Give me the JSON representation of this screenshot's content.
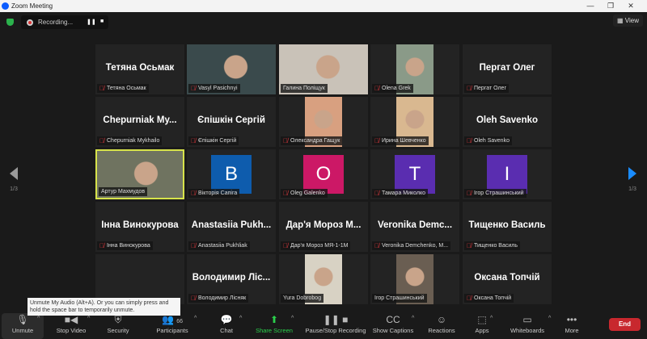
{
  "window": {
    "title": "Zoom Meeting",
    "minimize": "—",
    "maximize": "❐",
    "close": "✕"
  },
  "topbar": {
    "recording_label": "Recording...",
    "pause": "❚❚",
    "stop": "■",
    "view_label": "View",
    "view_icon": "▦"
  },
  "nav": {
    "page": "1/3",
    "page_right": "1/3"
  },
  "tiles": [
    {
      "type": "name",
      "display": "Тетяна Осьмак",
      "label": "Тетяна Осьмак",
      "muted": true
    },
    {
      "type": "video",
      "label": "Vasyl Pasichnyi",
      "muted": true,
      "color": "#3a4a4c"
    },
    {
      "type": "video",
      "label": "Галина Поліщук",
      "muted": false,
      "color": "#c9c2b8"
    },
    {
      "type": "photo",
      "label": "Olena Grek",
      "muted": true,
      "color": "#8a9a88"
    },
    {
      "type": "name",
      "display": "Пергат Олег",
      "label": "Пергат Олег",
      "muted": true
    },
    {
      "type": "name",
      "display": "Chepurniak  My...",
      "label": "Chepurniak Mykhailo",
      "muted": true
    },
    {
      "type": "name",
      "display": "Єпішкін Сергій",
      "label": "Єпішкін Сергій",
      "muted": true
    },
    {
      "type": "photo",
      "label": "Олександра Гащук",
      "muted": true,
      "color": "#d8a080"
    },
    {
      "type": "photo",
      "label": "Ирина Шевченко",
      "muted": true,
      "color": "#d9b890"
    },
    {
      "type": "name",
      "display": "Oleh Savenko",
      "label": "Oleh Savenko",
      "muted": true
    },
    {
      "type": "video",
      "label": "Артур Махмудов",
      "muted": false,
      "active": true,
      "color": "#6f7360"
    },
    {
      "type": "avatar",
      "letter": "B",
      "label": "Вікторія Сапіга",
      "muted": true,
      "color": "#0e5cad"
    },
    {
      "type": "avatar",
      "letter": "O",
      "label": "Oleg Galenko",
      "muted": true,
      "color": "#cc1866"
    },
    {
      "type": "avatar",
      "letter": "T",
      "label": "Тамара Миколко",
      "muted": true,
      "color": "#5a2db0"
    },
    {
      "type": "avatar",
      "letter": "I",
      "label": "Ігор Страшинський",
      "muted": true,
      "color": "#5a2db0"
    },
    {
      "type": "name",
      "display": "Інна Винокурова",
      "label": "Інна Винокурова",
      "muted": true
    },
    {
      "type": "name",
      "display": "Anastasiia  Pukh...",
      "label": "Anastasiia Pukhliak",
      "muted": true
    },
    {
      "type": "name",
      "display": "Дар'я  Мороз  М...",
      "label": "Дар'я Мороз МЯ-1-1М",
      "muted": true
    },
    {
      "type": "name",
      "display": "Veronika  Demc...",
      "label": "Veronika Demchenko, M...",
      "muted": true
    },
    {
      "type": "name",
      "display": "Тищенко Василь",
      "label": "Тищенко Василь",
      "muted": true
    },
    {
      "type": "empty"
    },
    {
      "type": "name",
      "display": "Володимир  Ліс...",
      "label": "Володимир Лісняк",
      "muted": true
    },
    {
      "type": "photo",
      "label": "Yura Dobrobog",
      "muted": false,
      "color": "#d8d2c4"
    },
    {
      "type": "photo",
      "label": "Ігор Страшинський",
      "muted": false,
      "color": "#6a5e52"
    },
    {
      "type": "name",
      "display": "Оксана Топчій",
      "label": "Оксана Топчій",
      "muted": true
    }
  ],
  "tooltip": "Unmute My Audio (Alt+A). Or you can simply press and hold the space bar to temporarily unmute.",
  "toolbar": [
    {
      "id": "unmute",
      "label": "Unmute",
      "icon": "🎙",
      "caret": true
    },
    {
      "id": "stop-video",
      "label": "Stop Video",
      "icon": "■◀",
      "caret": true
    },
    {
      "id": "security",
      "label": "Security",
      "icon": "⛨",
      "caret": false
    },
    {
      "id": "participants",
      "label": "Participants",
      "icon": "👥",
      "count": "66",
      "caret": true
    },
    {
      "id": "chat",
      "label": "Chat",
      "icon": "💬",
      "caret": true
    },
    {
      "id": "share-screen",
      "label": "Share Screen",
      "icon": "⬆",
      "caret": true,
      "color": "#2bd04c"
    },
    {
      "id": "pause-stop-recording",
      "label": "Pause/Stop Recording",
      "icon": "❚❚ ■",
      "caret": false
    },
    {
      "id": "show-captions",
      "label": "Show Captions",
      "icon": "CC",
      "caret": true
    },
    {
      "id": "reactions",
      "label": "Reactions",
      "icon": "☺",
      "caret": false
    },
    {
      "id": "apps",
      "label": "Apps",
      "icon": "⬚",
      "caret": true
    },
    {
      "id": "whiteboards",
      "label": "Whiteboards",
      "icon": "▭",
      "caret": true
    },
    {
      "id": "more",
      "label": "More",
      "icon": "•••",
      "caret": false
    }
  ],
  "end_label": "End"
}
